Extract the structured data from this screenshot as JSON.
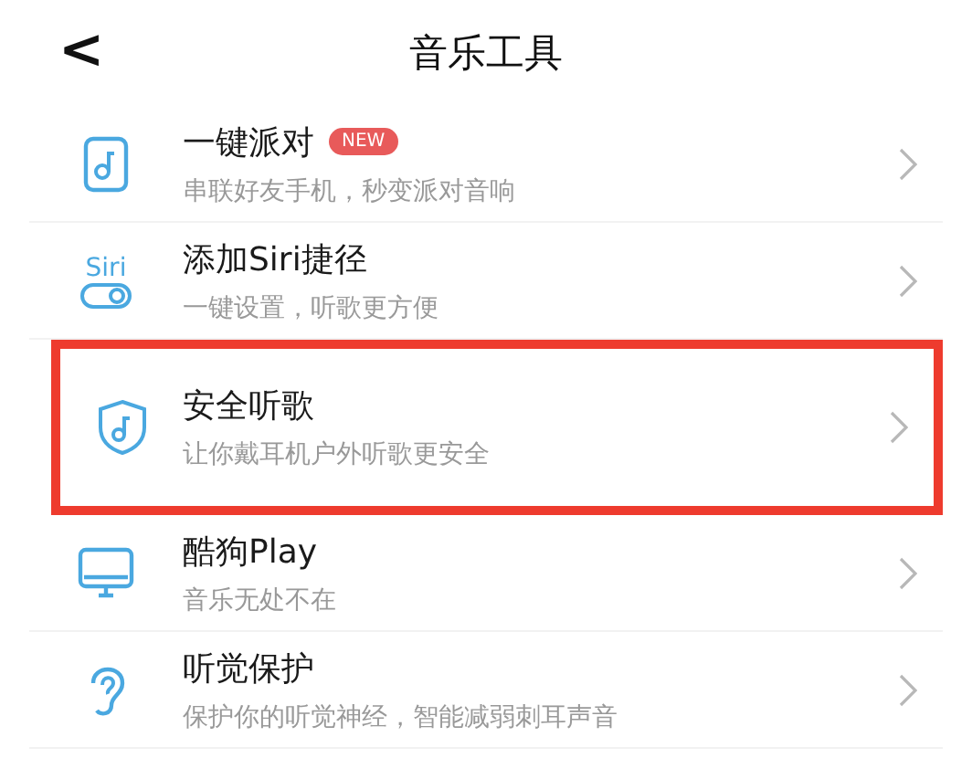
{
  "header": {
    "back": "<",
    "title": "音乐工具"
  },
  "items": [
    {
      "kind": "phone",
      "title": "一键派对",
      "badge": "NEW",
      "subtitle": "串联好友手机，秒变派对音响",
      "highlighted": false
    },
    {
      "kind": "siri",
      "icon_text": "Siri",
      "title": "添加Siri捷径",
      "subtitle": "一键设置，听歌更方便",
      "highlighted": false
    },
    {
      "kind": "shield",
      "title": "安全听歌",
      "subtitle": "让你戴耳机户外听歌更安全",
      "highlighted": true
    },
    {
      "kind": "monitor",
      "title": "酷狗Play",
      "subtitle": "音乐无处不在",
      "highlighted": false
    },
    {
      "kind": "ear",
      "title": "听觉保护",
      "subtitle": "保护你的听觉神经，智能减弱刺耳声音",
      "highlighted": false
    }
  ]
}
